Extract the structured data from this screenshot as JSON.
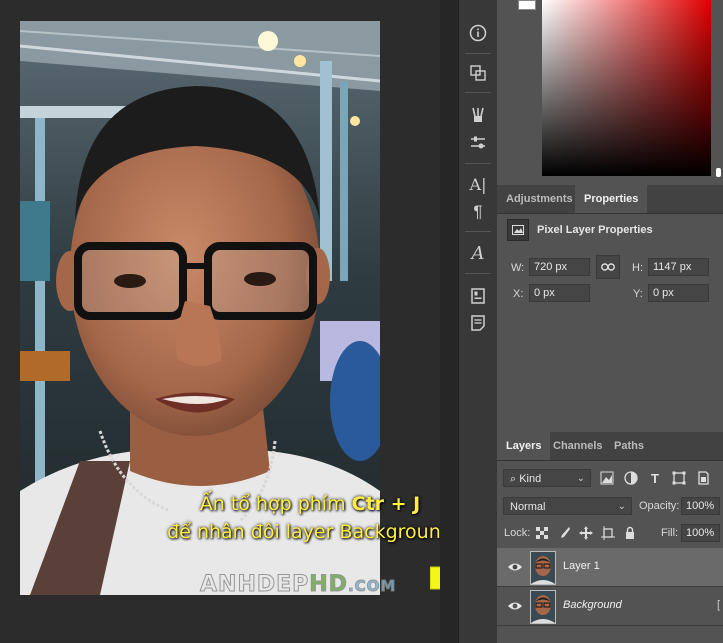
{
  "caption": {
    "line1_pre": "Ấn tổ hợp phím ",
    "line1_keys": "Ctr + J",
    "line2": "để nhân đôi layer Background"
  },
  "watermark": {
    "part1": "ANHDEP",
    "part2": "HD",
    "part3": ".COM"
  },
  "toolstrip": {
    "icons": [
      "info-icon",
      "layer-comps-icon",
      "brush-presets-icon",
      "adjust-sliders-icon",
      "character-icon",
      "paragraph-icon",
      "glyphs-icon",
      "libraries-icon",
      "notes-icon"
    ]
  },
  "props_tabs": {
    "adjustments": "Adjustments",
    "properties": "Properties"
  },
  "properties": {
    "title": "Pixel Layer Properties",
    "w_label": "W:",
    "w_value": "720 px",
    "h_label": "H:",
    "h_value": "1147 px",
    "x_label": "X:",
    "x_value": "0 px",
    "y_label": "Y:",
    "y_value": "0 px"
  },
  "layers_tabs": {
    "layers": "Layers",
    "channels": "Channels",
    "paths": "Paths"
  },
  "layers_panel": {
    "filter_kind": "Kind",
    "blend_mode": "Normal",
    "opacity_label": "Opacity:",
    "opacity_value": "100%",
    "lock_label": "Lock:",
    "fill_label": "Fill:",
    "fill_value": "100%",
    "layers": [
      {
        "name": "Layer 1",
        "selected": true
      },
      {
        "name": "Background",
        "selected": false
      }
    ]
  },
  "colors": {
    "accent_yellow": "#ffee40",
    "arrow": "#f5f51a",
    "panel": "#535353"
  }
}
